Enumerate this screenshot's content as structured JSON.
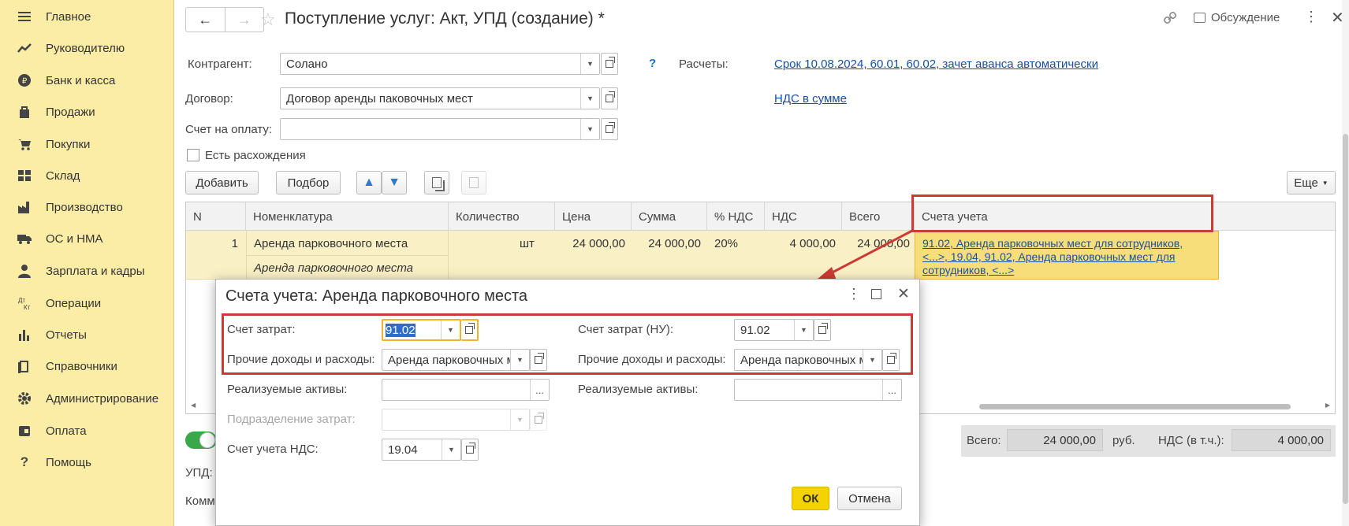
{
  "sidebar": {
    "items": [
      {
        "label": "Главное",
        "icon": "menu-icon"
      },
      {
        "label": "Руководителю",
        "icon": "trend-icon"
      },
      {
        "label": "Банк и касса",
        "icon": "coin-icon"
      },
      {
        "label": "Продажи",
        "icon": "bag-icon"
      },
      {
        "label": "Покупки",
        "icon": "cart-icon"
      },
      {
        "label": "Склад",
        "icon": "warehouse-icon"
      },
      {
        "label": "Производство",
        "icon": "factory-icon"
      },
      {
        "label": "ОС и НМА",
        "icon": "truck-icon"
      },
      {
        "label": "Зарплата и кадры",
        "icon": "person-icon"
      },
      {
        "label": "Операции",
        "icon": "dt-kt-icon"
      },
      {
        "label": "Отчеты",
        "icon": "bar-chart-icon"
      },
      {
        "label": "Справочники",
        "icon": "books-icon"
      },
      {
        "label": "Администрирование",
        "icon": "gear-icon"
      },
      {
        "label": "Оплата",
        "icon": "wallet-icon"
      },
      {
        "label": "Помощь",
        "icon": "help-icon"
      }
    ]
  },
  "header": {
    "title": "Поступление услуг: Акт, УПД (создание) *",
    "discussion": "Обсуждение"
  },
  "form": {
    "counterparty_label": "Контрагент:",
    "counterparty_value": "Солано",
    "contract_label": "Договор:",
    "contract_value": "Договор аренды паковочных мест",
    "invoice_label": "Счет на оплату:",
    "invoice_value": "",
    "help_mark": "?",
    "settlements_label": "Расчеты:",
    "settlements_link": "Срок 10.08.2024, 60.01, 60.02, зачет аванса автоматически",
    "vat_link": "НДС в сумме",
    "discrepancy_label": "Есть расхождения",
    "add_button": "Добавить",
    "select_button": "Подбор",
    "more_button": "Еще"
  },
  "table": {
    "columns": [
      "N",
      "Номенклатура",
      "Количество",
      "Цена",
      "Сумма",
      "% НДС",
      "НДС",
      "Всего",
      "Счета учета"
    ],
    "rows": [
      {
        "n": "1",
        "item": "Аренда парковочного места",
        "item_sub": "Аренда парковочного места",
        "unit": "шт",
        "price": "24 000,00",
        "sum": "24 000,00",
        "vat_rate": "20%",
        "vat": "4 000,00",
        "total": "24 000,00",
        "accounts": "91.02, Аренда парковочных мест для сотрудников, <...>, 19.04, 91.02, Аренда парковочных мест для сотрудников, <...>"
      }
    ]
  },
  "totals": {
    "total_label": "Всего:",
    "total_value": "24 000,00",
    "currency": "руб.",
    "vat_label": "НДС (в т.ч.):",
    "vat_value": "4 000,00"
  },
  "bottom": {
    "upd_label": "УПД:",
    "comment_label": "Комм"
  },
  "modal": {
    "title": "Счета учета: Аренда парковочного места",
    "cost_account_label": "Счет затрат:",
    "cost_account_value": "91.02",
    "cost_account_nu_label": "Счет затрат (НУ):",
    "cost_account_nu_value": "91.02",
    "other_label": "Прочие доходы и расходы:",
    "other_value": "Аренда парковочных мест",
    "other_nu_label": "Прочие доходы и расходы:",
    "other_nu_value": "Аренда парковочных мест",
    "assets_label": "Реализуемые активы:",
    "assets_value": "",
    "assets_nu_label": "Реализуемые активы:",
    "assets_nu_value": "",
    "division_label": "Подразделение затрат:",
    "division_value": "",
    "vat_account_label": "Счет учета НДС:",
    "vat_account_value": "19.04",
    "ok_button": "ОК",
    "cancel_button": "Отмена",
    "ellipsis": "..."
  },
  "colors": {
    "sidebar_bg": "#fbeda6",
    "highlight_red": "#cc3a36",
    "ok_yellow": "#f5d300",
    "row_selected": "#faf0c6",
    "link_blue": "#1a4fa0"
  }
}
